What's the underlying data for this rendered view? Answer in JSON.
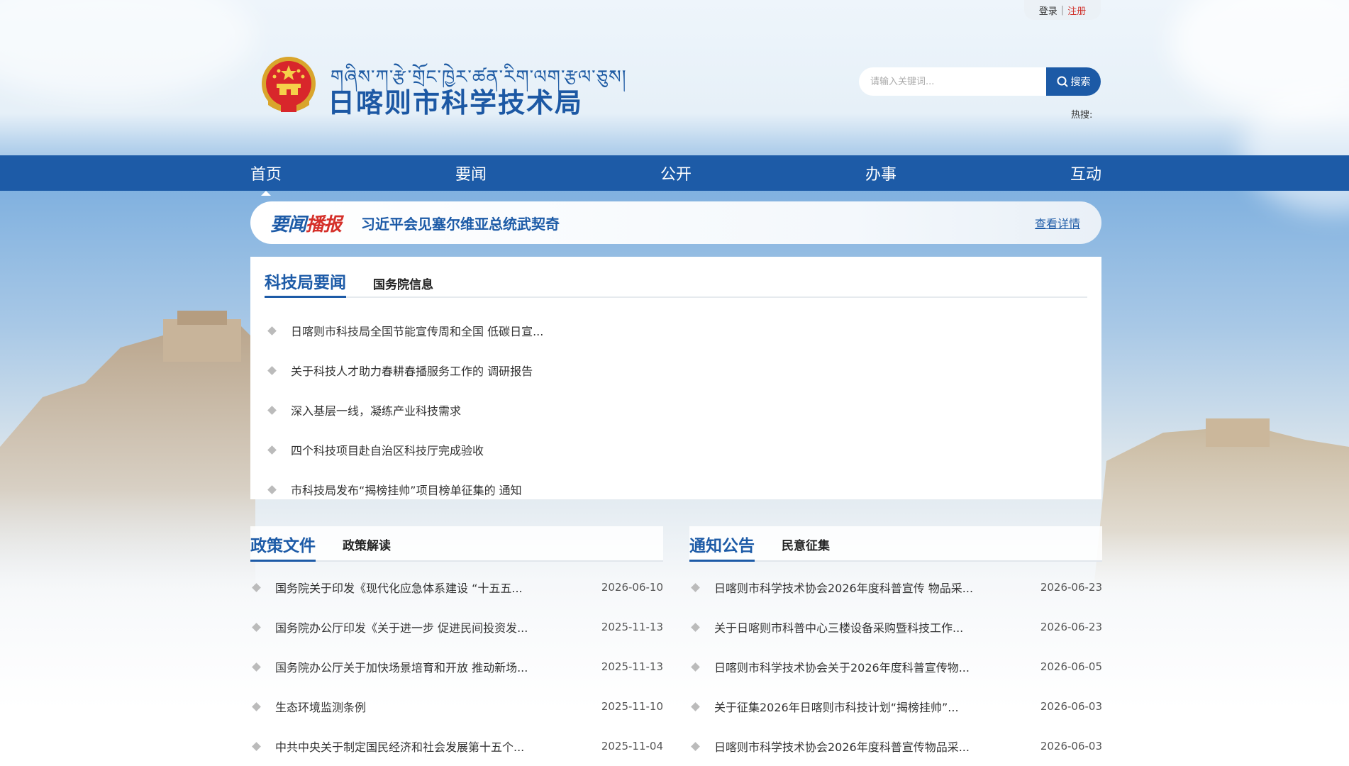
{
  "top": {
    "login": "登录",
    "separator": "|",
    "register": "注册"
  },
  "header": {
    "tibetan_name": "གཞིས་ཀ་རྩེ་གྲོང་ཁྱེར་ཚན་རིག་ལག་རྩལ་ཅུས།",
    "site_name": "日喀则市科学技术局",
    "search_placeholder": "请输入关键词...",
    "search_label": "搜索",
    "hot_search_label": "热搜:"
  },
  "nav": {
    "items": [
      {
        "label": "首页"
      },
      {
        "label": "要闻"
      },
      {
        "label": "公开"
      },
      {
        "label": "办事"
      },
      {
        "label": "互动"
      }
    ]
  },
  "headline": {
    "logo_a": "要闻",
    "logo_b": "播报",
    "text": "习近平会见塞尔维亚总统武契奇",
    "more": "查看详情"
  },
  "news": {
    "tab_active": "科技局要闻",
    "tab_other": "国务院信息",
    "items": [
      "日喀则市科技局全国节能宣传周和全国 低碳日宣...",
      "关于科技人才助力春耕春播服务工作的 调研报告",
      "深入基层一线，凝练产业科技需求",
      "四个科技项目赴自治区科技厅完成验收",
      "市科技局发布“揭榜挂帅”项目榜单征集的 通知"
    ]
  },
  "policy": {
    "tab_active": "政策文件",
    "tab_other": "政策解读",
    "items": [
      {
        "title": "国务院关于印发《现代化应急体系建设 “十五五...",
        "date": "2026-06-10"
      },
      {
        "title": "国务院办公厅印发《关于进一步 促进民间投资发...",
        "date": "2025-11-13"
      },
      {
        "title": "国务院办公厅关于加快场景培育和开放 推动新场...",
        "date": "2025-11-13"
      },
      {
        "title": "生态环境监测条例",
        "date": "2025-11-10"
      },
      {
        "title": "中共中央关于制定国民经济和社会发展第十五个...",
        "date": "2025-11-04"
      }
    ]
  },
  "notice": {
    "tab_active": "通知公告",
    "tab_other": "民意征集",
    "items": [
      {
        "title": "日喀则市科学技术协会2026年度科普宣传 物品采...",
        "date": "2026-06-23"
      },
      {
        "title": "关于日喀则市科普中心三楼设备采购暨科技工作...",
        "date": "2026-06-23"
      },
      {
        "title": "日喀则市科学技术协会关于2026年度科普宣传物...",
        "date": "2026-06-05"
      },
      {
        "title": "关于征集2026年日喀则市科技计划“揭榜挂帅”...",
        "date": "2026-06-03"
      },
      {
        "title": "日喀则市科学技术协会2026年度科普宣传物品采...",
        "date": "2026-06-03"
      }
    ]
  }
}
